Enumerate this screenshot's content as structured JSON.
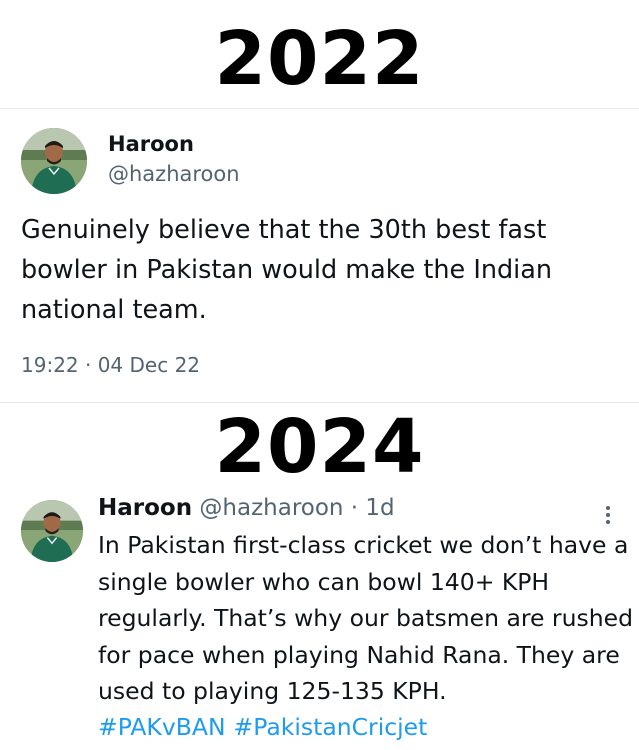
{
  "section_top": {
    "year": "2022",
    "tweet": {
      "display_name": "Haroon",
      "handle": "@hazharoon",
      "text": "Genuinely believe that the 30th best fast bowler in Pakistan would make the Indian national team.",
      "timestamp": "19:22 · 04 Dec 22"
    }
  },
  "section_bottom": {
    "year": "2024",
    "tweet": {
      "display_name": "Haroon",
      "handle_meta": "@hazharoon · 1d",
      "text": "In Pakistan first-class cricket we don’t have a single bowler who can bowl 140+ KPH regularly. That’s why our batsmen are rushed for pace when playing Nahid Rana. They are used to playing 125-135 KPH.",
      "hashtags": [
        "#PAKvBAN",
        "#PakistanCricjet"
      ]
    }
  },
  "colors": {
    "text_primary": "#0f1419",
    "text_secondary": "#536471",
    "link": "#1d9bf0",
    "divider": "#e6e9ec"
  },
  "icons": {
    "more": "more-vertical-icon"
  }
}
